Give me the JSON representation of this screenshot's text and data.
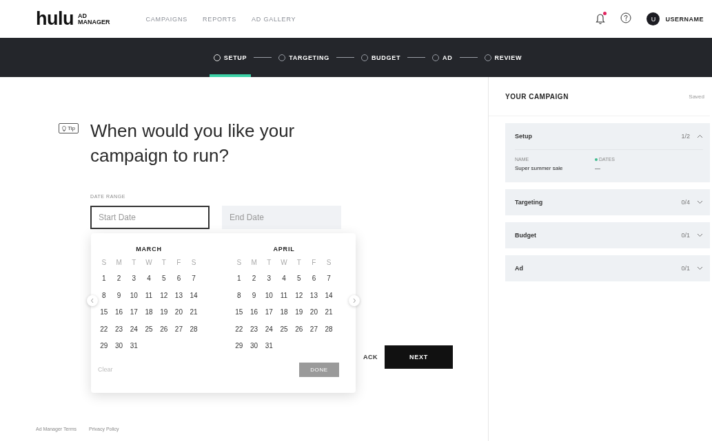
{
  "header": {
    "logo": {
      "wordmark": "hulu",
      "top": "AD",
      "bottom": "MANAGER"
    },
    "nav": [
      {
        "label": "CAMPAIGNS",
        "selected": false
      },
      {
        "label": "REPORTS",
        "selected": false
      },
      {
        "label": "AD GALLERY",
        "selected": false
      }
    ],
    "notifications": {
      "unread": true
    },
    "user": {
      "initial": "U",
      "name": "USERNAME"
    }
  },
  "steps": [
    {
      "label": "SETUP",
      "selected": true
    },
    {
      "label": "TARGETING",
      "selected": false
    },
    {
      "label": "BUDGET",
      "selected": false
    },
    {
      "label": "AD",
      "selected": false
    },
    {
      "label": "REVIEW",
      "selected": false
    }
  ],
  "question": {
    "tip": "Tip",
    "title": "When would you like your campaign to run?"
  },
  "date_range": {
    "label": "DATE RANGE",
    "start": {
      "placeholder": "Start Date",
      "focused": true
    },
    "end": {
      "placeholder": "End Date",
      "disabled": true
    }
  },
  "calendar": {
    "months": [
      {
        "name": "MARCH",
        "weekdays": [
          "S",
          "M",
          "T",
          "W",
          "T",
          "F",
          "S"
        ],
        "weeks": [
          [
            "1",
            "2",
            "3",
            "4",
            "5",
            "6",
            "7"
          ],
          [
            "8",
            "9",
            "10",
            "11",
            "12",
            "13",
            "14"
          ],
          [
            "15",
            "16",
            "17",
            "18",
            "19",
            "20",
            "21"
          ],
          [
            "22",
            "23",
            "24",
            "25",
            "26",
            "27",
            "28"
          ],
          [
            "29",
            "30",
            "31"
          ]
        ]
      },
      {
        "name": "APRIL",
        "weekdays": [
          "S",
          "M",
          "T",
          "W",
          "T",
          "F",
          "S"
        ],
        "weeks": [
          [
            "1",
            "2",
            "3",
            "4",
            "5",
            "6",
            "7"
          ],
          [
            "8",
            "9",
            "10",
            "11",
            "12",
            "13",
            "14"
          ],
          [
            "15",
            "16",
            "17",
            "18",
            "19",
            "20",
            "21"
          ],
          [
            "22",
            "23",
            "24",
            "25",
            "26",
            "27",
            "28"
          ],
          [
            "29",
            "30",
            "31"
          ]
        ]
      }
    ],
    "clear": {
      "label": "Clear",
      "disabled": true
    },
    "done": {
      "label": "DONE",
      "disabled": true
    }
  },
  "actions": {
    "back": "ACK",
    "next": "NEXT"
  },
  "footer": [
    "Ad Manager Terms",
    "Privacy Policy"
  ],
  "campaign": {
    "title": "YOUR CAMPAIGN",
    "status": "Saved",
    "sections": [
      {
        "title": "Setup",
        "progress": "1/2",
        "expanded": true,
        "fields": [
          {
            "label": "NAME",
            "value": "Super summer sale",
            "highlighted": false
          },
          {
            "label": "DATES",
            "value": "—",
            "highlighted": true
          }
        ]
      },
      {
        "title": "Targeting",
        "progress": "0/4",
        "expanded": false
      },
      {
        "title": "Budget",
        "progress": "0/1",
        "expanded": false
      },
      {
        "title": "Ad",
        "progress": "0/1",
        "expanded": false
      }
    ]
  }
}
